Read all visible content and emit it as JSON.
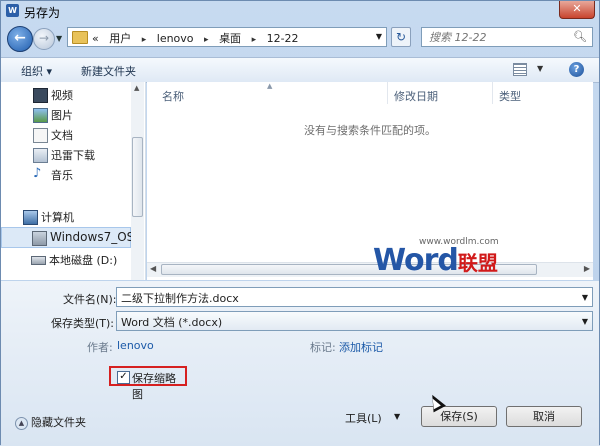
{
  "window": {
    "title": "另存为",
    "app_icon": "W",
    "close": "✕"
  },
  "nav": {
    "breadcrumbs": [
      "«",
      "用户",
      "▸",
      "lenovo",
      "▸",
      "桌面",
      "▸",
      "12-22"
    ],
    "search_placeholder": "搜索 12-22"
  },
  "toolbar": {
    "organize": "组织 ▾",
    "new_folder": "新建文件夹",
    "help": "?"
  },
  "sidebar": {
    "items": [
      {
        "label": "视频",
        "icon": "video-icon"
      },
      {
        "label": "图片",
        "icon": "picture-icon"
      },
      {
        "label": "文档",
        "icon": "document-icon"
      },
      {
        "label": "迅雷下载",
        "icon": "thunder-download-icon"
      },
      {
        "label": "音乐",
        "icon": "music-icon"
      },
      {
        "label": "计算机",
        "icon": "computer-icon"
      },
      {
        "label": "Windows7_OS (",
        "icon": "drive-os-icon"
      },
      {
        "label": "本地磁盘 (D:)",
        "icon": "drive-icon"
      }
    ]
  },
  "files": {
    "columns": [
      "名称",
      "修改日期",
      "类型"
    ],
    "empty_message": "没有与搜索条件匹配的项。"
  },
  "watermark": {
    "url": "www.wordlm.com",
    "word": "Word",
    "suffix": "联盟"
  },
  "form": {
    "filename_label": "文件名(N):",
    "filename_value": "二级下拉制作方法.docx",
    "type_label": "保存类型(T):",
    "type_value": "Word 文档 (*.docx)",
    "author_label": "作者:",
    "author_value": "lenovo",
    "tags_label": "标记:",
    "tags_value": "添加标记",
    "thumbnail_label": "保存缩略图",
    "thumbnail_checked": "✓",
    "hide_folders": "隐藏文件夹",
    "tools": "工具(L)",
    "save": "保存(S)",
    "cancel": "取消"
  }
}
